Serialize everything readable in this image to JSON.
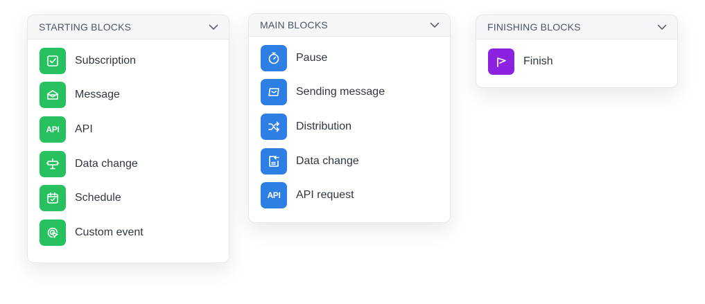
{
  "panels": {
    "starting": {
      "title": "STARTING BLOCKS",
      "items": [
        {
          "label": "Subscription",
          "icon": "checkbox-icon"
        },
        {
          "label": "Message",
          "icon": "envelope-open-icon"
        },
        {
          "label": "API",
          "icon": "api-icon"
        },
        {
          "label": "Data change",
          "icon": "data-change-icon"
        },
        {
          "label": "Schedule",
          "icon": "calendar-check-icon"
        },
        {
          "label": "Custom event",
          "icon": "cursor-target-icon"
        }
      ]
    },
    "main": {
      "title": "MAIN BLOCKS",
      "items": [
        {
          "label": "Pause",
          "icon": "stopwatch-icon"
        },
        {
          "label": "Sending message",
          "icon": "send-message-icon"
        },
        {
          "label": "Distribution",
          "icon": "shuffle-icon"
        },
        {
          "label": "Data change",
          "icon": "document-arrow-icon"
        },
        {
          "label": "API request",
          "icon": "api-icon"
        }
      ]
    },
    "finishing": {
      "title": "FINISHING BLOCKS",
      "items": [
        {
          "label": "Finish",
          "icon": "flag-icon"
        }
      ]
    }
  },
  "api_icon_text": "API",
  "colors": {
    "starting_accent": "#27c25f",
    "main_accent": "#2d7fe3",
    "finishing_accent": "#8b22e0"
  }
}
